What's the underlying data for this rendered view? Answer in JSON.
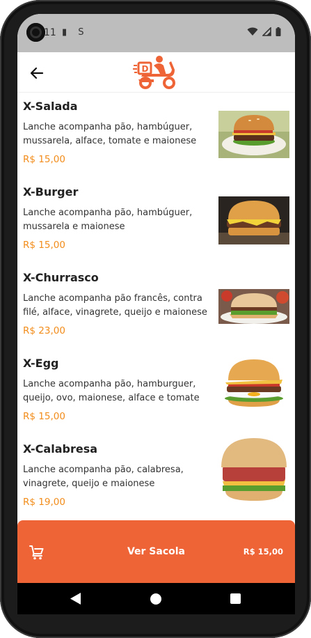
{
  "status_bar": {
    "time_fragment": "11",
    "left_icons": "▮ S"
  },
  "header": {
    "logo_icon": "delivery-scooter-logo",
    "back_icon": "arrow-left-icon"
  },
  "menu": {
    "items": [
      {
        "name": "X-Salada",
        "description": "Lanche acompanha pão, hambúguer, mussarela, alface, tomate e maionese",
        "price": "R$ 15,00"
      },
      {
        "name": "X-Burger",
        "description": "Lanche acompanha pão, hambúguer, mussarela e maionese",
        "price": "R$ 15,00"
      },
      {
        "name": "X-Churrasco",
        "description": "Lanche acompanha pão francês, contra filé, alface, vinagrete, queijo e maionese",
        "price": "R$ 23,00"
      },
      {
        "name": "X-Egg",
        "description": "Lanche acompanha pão, hamburguer, queijo, ovo, maionese, alface e tomate",
        "price": "R$ 15,00"
      },
      {
        "name": "X-Calabresa",
        "description": "Lanche acompanha pão, calabresa, vinagrete, queijo e maionese",
        "price": "R$ 19,00"
      }
    ]
  },
  "cart": {
    "label": "Ver Sacola",
    "total": "R$ 15,00",
    "icon": "shopping-cart-icon"
  },
  "colors": {
    "accent": "#ee6436",
    "price": "#f28c1a"
  }
}
